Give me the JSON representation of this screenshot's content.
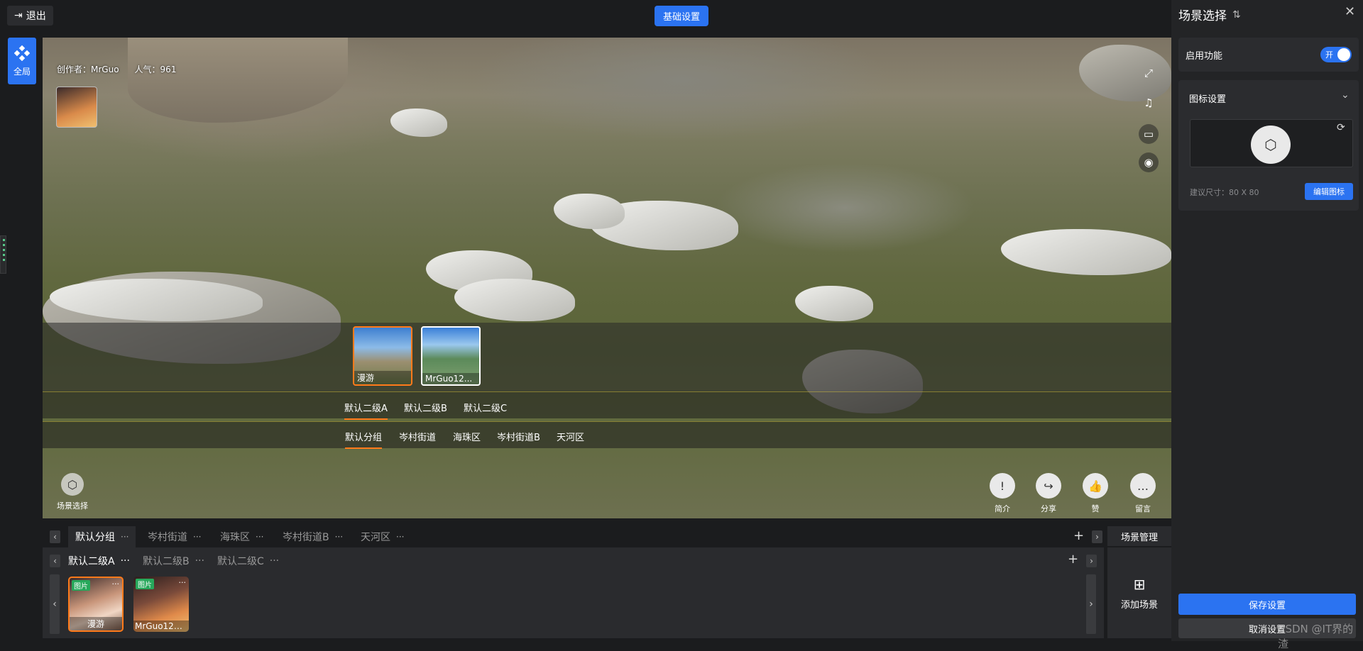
{
  "topbar": {
    "exit_label": "退出",
    "basic_settings_label": "基础设置"
  },
  "left_rail": {
    "global_label": "全局"
  },
  "viewer": {
    "creator_label": "创作者：MrGuo",
    "popularity_label": "人气：961",
    "scenes": [
      {
        "label": "漫游"
      },
      {
        "label": "MrGuo12..."
      }
    ],
    "level2_tabs": [
      "默认二级A",
      "默认二级B",
      "默认二级C"
    ],
    "level1_tabs": [
      "默认分组",
      "岑村街道",
      "海珠区",
      "岑村街道B",
      "天河区"
    ],
    "scene_select_label": "场景选择",
    "actions": [
      {
        "label": "简介",
        "icon": "info-icon"
      },
      {
        "label": "分享",
        "icon": "share-icon"
      },
      {
        "label": "赞",
        "icon": "thumb-up-icon"
      },
      {
        "label": "留言",
        "icon": "comment-icon"
      }
    ]
  },
  "bottom": {
    "group_tabs": [
      "默认分组",
      "岑村街道",
      "海珠区",
      "岑村街道B",
      "天河区"
    ],
    "sub_tabs": [
      "默认二级A",
      "默认二级B",
      "默认二级C"
    ],
    "cards": [
      {
        "tag": "图片",
        "name": "漫游"
      },
      {
        "tag": "图片",
        "name": "MrGuo1231..."
      }
    ],
    "scene_mgmt_label": "场景管理",
    "add_scene_label": "添加场景"
  },
  "right_panel": {
    "title": "场景选择",
    "enable_label": "启用功能",
    "toggle_label": "开",
    "icon_settings_title": "图标设置",
    "size_hint": "建议尺寸：80 X 80",
    "edit_icon_label": "编辑图标",
    "save_label": "保存设置",
    "cancel_label": "取消设置",
    "watermark": "CSDN @IT界的渣"
  },
  "colors": {
    "accent": "#2b73f1",
    "active_tab": "#ff7a1a",
    "tag_green": "#27a85b"
  }
}
